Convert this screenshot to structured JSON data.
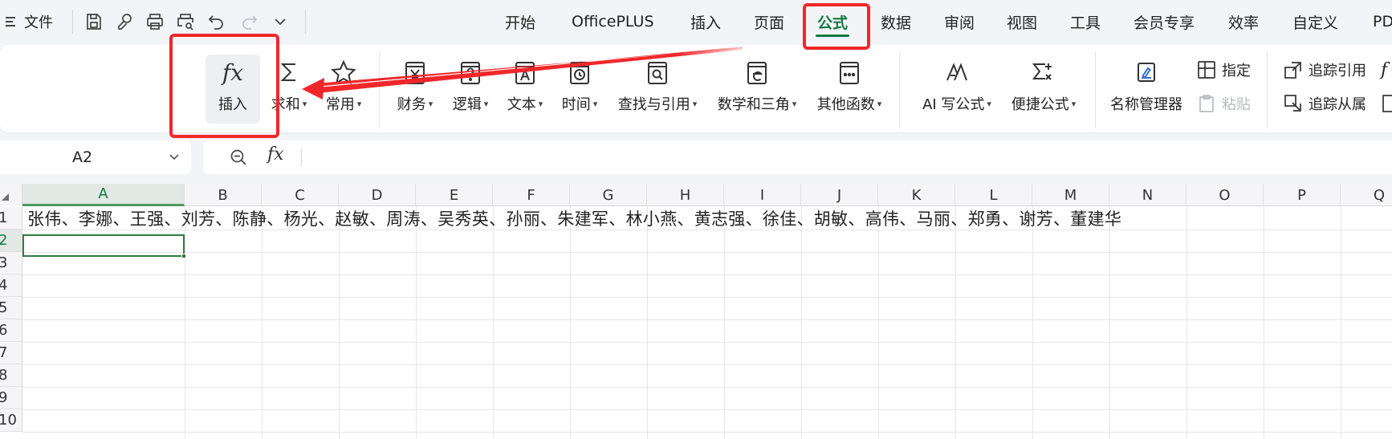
{
  "menubar": {
    "menu_icon": "hamburger-icon",
    "file_label": "文件",
    "quick_access_icons": [
      "save-icon",
      "format-painter-icon",
      "print-icon",
      "print-preview-icon",
      "undo-icon",
      "redo-icon",
      "more-chevron-icon"
    ],
    "tabs": [
      "开始",
      "OfficePLUS",
      "插入",
      "页面",
      "公式",
      "数据",
      "审阅",
      "视图",
      "工具",
      "会员专享",
      "效率",
      "自定义",
      "PD"
    ],
    "active_tab": "公式"
  },
  "ribbon": {
    "insert_fx_symbol": "fx",
    "insert_label": "插入",
    "sum_label": "求和",
    "common_label": "常用",
    "finance_label": "财务",
    "logic_label": "逻辑",
    "text_label": "文本",
    "time_label": "时间",
    "lookup_label": "查找与引用",
    "math_label": "数学和三角",
    "other_label": "其他函数",
    "ai_formula_label": "AI 写公式",
    "quick_formula_label": "便捷公式",
    "name_manager_label": "名称管理器",
    "specify_label": "指定",
    "paste_label": "粘贴",
    "trace_precedents_label": "追踪引用",
    "trace_dependents_label": "追踪从属",
    "partial_fx": "f"
  },
  "formula_bar": {
    "name_box_value": "A2",
    "fx_symbol": "fx",
    "content": ""
  },
  "grid": {
    "columns": [
      "A",
      "B",
      "C",
      "D",
      "E",
      "F",
      "G",
      "H",
      "I",
      "J",
      "K",
      "L",
      "M",
      "N",
      "O",
      "P",
      "Q"
    ],
    "rows": [
      "1",
      "2",
      "3",
      "4",
      "5",
      "6",
      "7",
      "8",
      "9",
      "10"
    ],
    "selected_column": "A",
    "selected_row": "2",
    "cells": {
      "A1": "张伟、李娜、王强、刘芳、陈静、杨光、赵敏、周涛、吴秀英、孙丽、朱建军、林小燕、黄志强、徐佳、胡敏、高伟、马丽、郑勇、谢芳、董建华"
    }
  },
  "colors": {
    "accent": "#127a43",
    "annotation": "#f0272a",
    "selection_border": "#2f7d3f"
  }
}
